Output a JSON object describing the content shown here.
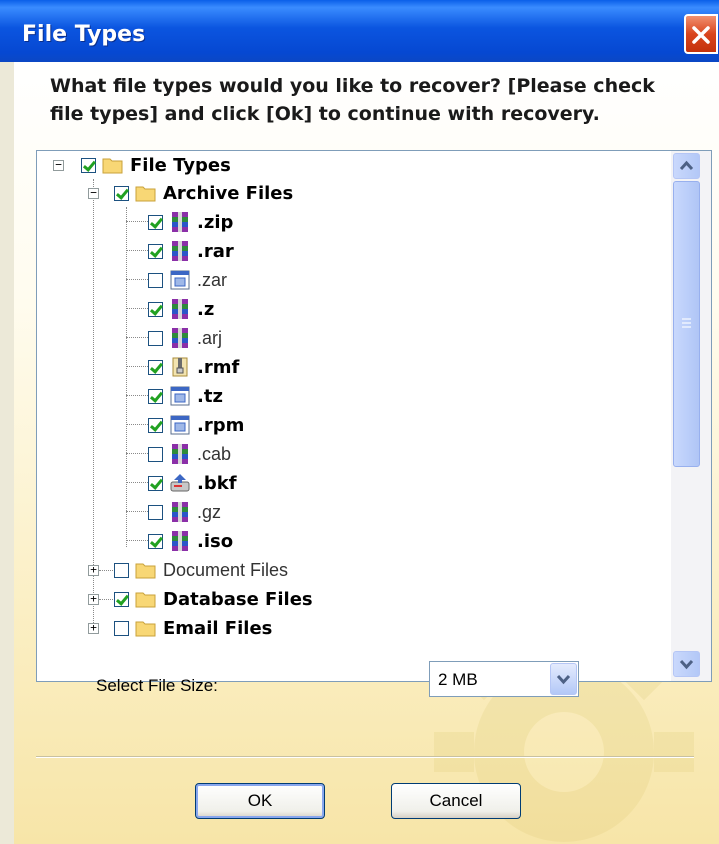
{
  "window": {
    "title": "File Types"
  },
  "prompt": "What file types would you like to recover? [Please check file types] and click [Ok] to continue with recovery.",
  "tree": {
    "root": {
      "label": "File Types",
      "checked": true,
      "expanded": true
    },
    "archive": {
      "label": "Archive Files",
      "checked": true,
      "expanded": true
    },
    "archive_items": [
      {
        "label": ".zip",
        "checked": true,
        "icon": "archive-stack-icon"
      },
      {
        "label": ".rar",
        "checked": true,
        "icon": "archive-stack-icon"
      },
      {
        "label": ".zar",
        "checked": false,
        "icon": "window-app-icon"
      },
      {
        "label": ".z",
        "checked": true,
        "icon": "archive-stack-icon"
      },
      {
        "label": ".arj",
        "checked": false,
        "icon": "archive-stack-icon"
      },
      {
        "label": ".rmf",
        "checked": true,
        "icon": "zip-folder-icon"
      },
      {
        "label": ".tz",
        "checked": true,
        "icon": "window-app-icon"
      },
      {
        "label": ".rpm",
        "checked": true,
        "icon": "window-app-icon"
      },
      {
        "label": ".cab",
        "checked": false,
        "icon": "archive-stack-icon"
      },
      {
        "label": ".bkf",
        "checked": true,
        "icon": "backup-drive-icon"
      },
      {
        "label": ".gz",
        "checked": false,
        "icon": "archive-stack-icon"
      },
      {
        "label": ".iso",
        "checked": true,
        "icon": "archive-stack-icon"
      }
    ],
    "document": {
      "label": "Document Files",
      "checked": false,
      "expanded": false
    },
    "database": {
      "label": "Database Files",
      "checked": true,
      "expanded": false
    },
    "email": {
      "label": "Email Files",
      "checked": false,
      "expanded": false
    }
  },
  "file_size": {
    "label": "Select File Size:",
    "value": "2 MB"
  },
  "buttons": {
    "ok": "OK",
    "cancel": "Cancel"
  },
  "colors": {
    "titlebar": "#0B55E0",
    "check": "#21A121",
    "frame": "#ECE9D8"
  }
}
